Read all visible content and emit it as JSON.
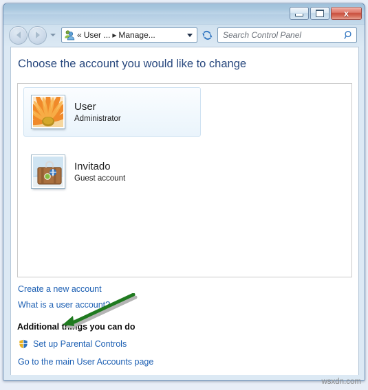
{
  "window": {
    "caption_buttons": {
      "minimize_label": "Minimize",
      "maximize_label": "Maximize",
      "close_label": "x"
    }
  },
  "toolbar": {
    "back_label": "Back",
    "forward_label": "Forward",
    "recent_pages_label": "Recent pages",
    "breadcrumb_icon": "user-accounts-icon",
    "breadcrumb": {
      "overflow": "«",
      "items": [
        "User ...",
        "Manage..."
      ],
      "separator": "▸"
    },
    "refresh_label": "Refresh",
    "search": {
      "placeholder": "Search Control Panel",
      "value": "",
      "icon": "search-icon"
    }
  },
  "main": {
    "heading": "Choose the account you would like to change",
    "accounts": [
      {
        "name": "User",
        "role": "Administrator",
        "avatar": "sunflower-avatar",
        "selected": true
      },
      {
        "name": "Invitado",
        "role": "Guest account",
        "avatar": "suitcase-avatar",
        "selected": false
      }
    ],
    "links": [
      {
        "label": "Create a new account"
      },
      {
        "label": "What is a user account?"
      }
    ],
    "additional_section": {
      "heading": "Additional things you can do",
      "links": [
        {
          "label": "Set up Parental Controls",
          "icon": "uac-shield-icon"
        },
        {
          "label": "Go to the main User Accounts page",
          "icon": null
        }
      ]
    }
  },
  "annotation": {
    "type": "arrow",
    "color": "#1f7a1f",
    "points_to": "Create a new account"
  },
  "watermark": {
    "text": "wsxdn.com"
  },
  "colors": {
    "accent_link": "#1c5fb3",
    "heading": "#27477d",
    "frame": "#6a8ab0",
    "close_button": "#c9503f",
    "annotation_green": "#1f7a1f"
  }
}
